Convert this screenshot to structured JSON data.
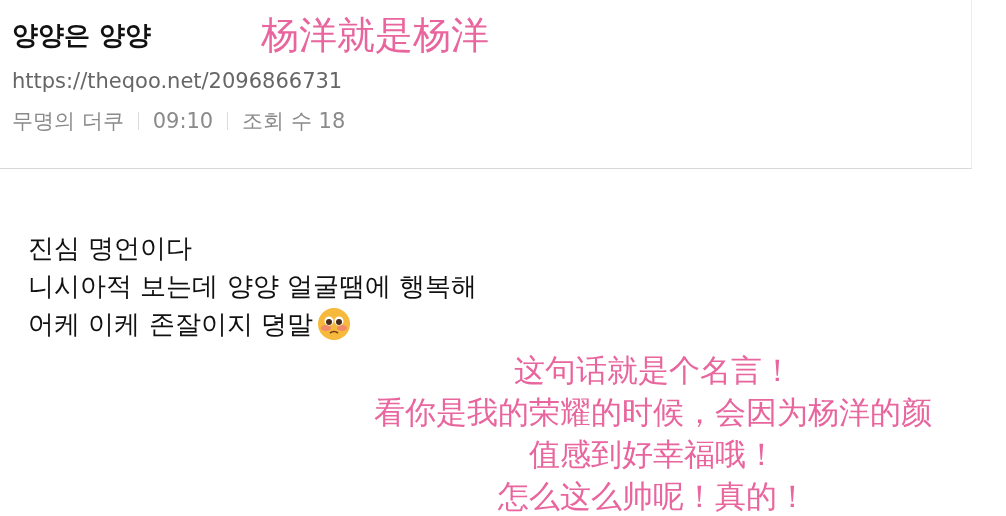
{
  "post": {
    "title": "양양은 양양",
    "url": "https://theqoo.net/2096866731",
    "meta": [
      "무명의 더쿠",
      "09:10",
      "조회 수 18"
    ],
    "body_lines": [
      "진심 명언이다",
      "니시아적 보는데 양양 얼굴땜에 행복해",
      "어케 이케 존잘이지 뎡말"
    ]
  },
  "annotations": {
    "title_translation": "杨洋就是杨洋",
    "body_translation": [
      "这句话就是个名言！",
      "看你是我的荣耀的时候，会因为杨洋的颜",
      "值感到好幸福哦！",
      "怎么这么帅呢！真的！"
    ]
  }
}
